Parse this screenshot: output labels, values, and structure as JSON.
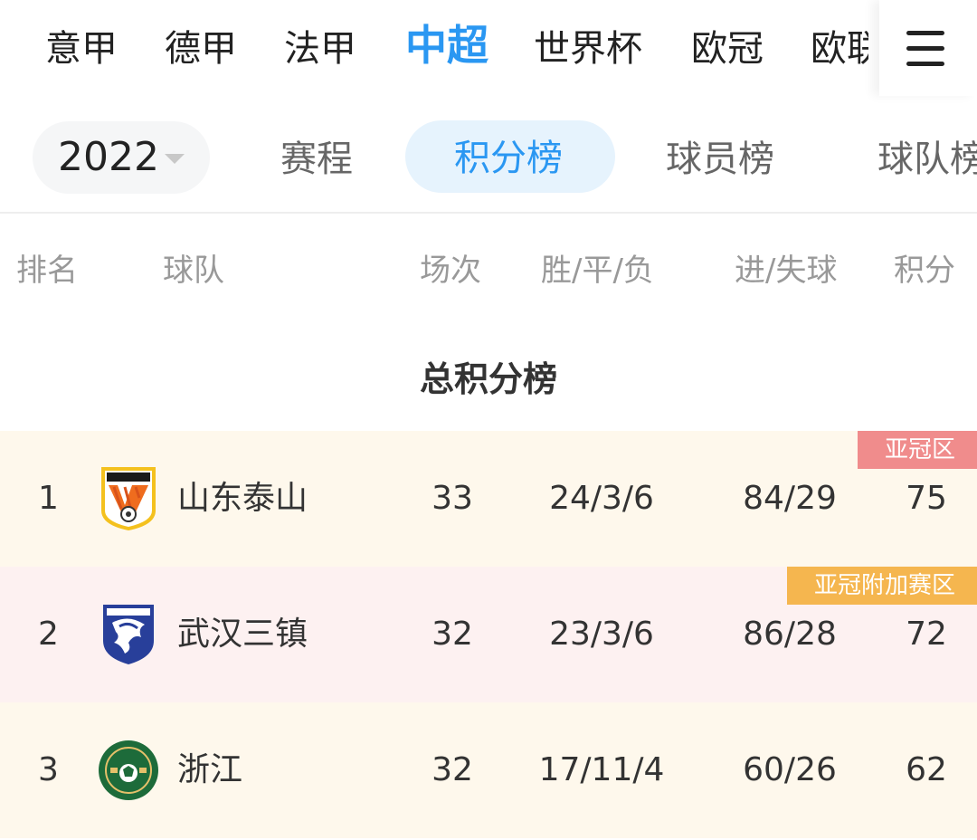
{
  "league_nav": {
    "items": [
      "意甲",
      "德甲",
      "法甲",
      "中超",
      "世界杯",
      "欧冠",
      "欧联"
    ],
    "active": "中超"
  },
  "sub_nav": {
    "year": "2022",
    "tabs": [
      "赛程",
      "积分榜",
      "球员榜",
      "球队榜"
    ],
    "active": "积分榜"
  },
  "table": {
    "columns": [
      "排名",
      "球队",
      "场次",
      "胜/平/负",
      "进/失球",
      "积分"
    ],
    "section_title": "总积分榜",
    "rows": [
      {
        "rank": "1",
        "team": "山东泰山",
        "played": "33",
        "wdl": "24/3/6",
        "goals": "84/29",
        "points": "75",
        "zone": "亚冠区",
        "zone_color": "#f08c8c",
        "row_bg": "#fef8ec",
        "logo": "tsfc-shield-icon"
      },
      {
        "rank": "2",
        "team": "武汉三镇",
        "played": "32",
        "wdl": "23/3/6",
        "goals": "86/28",
        "points": "72",
        "zone": "亚冠附加赛区",
        "zone_color": "#f5b64f",
        "row_bg": "#fdf1f1",
        "logo": "wuhan-shield-icon"
      },
      {
        "rank": "3",
        "team": "浙江",
        "played": "32",
        "wdl": "17/11/4",
        "goals": "60/26",
        "points": "62",
        "zone": "",
        "zone_color": "",
        "row_bg": "#fef8ec",
        "logo": "zhejiang-badge-icon"
      }
    ]
  },
  "colors": {
    "accent": "#2a97f2",
    "accent_bg": "#e6f3fd"
  }
}
